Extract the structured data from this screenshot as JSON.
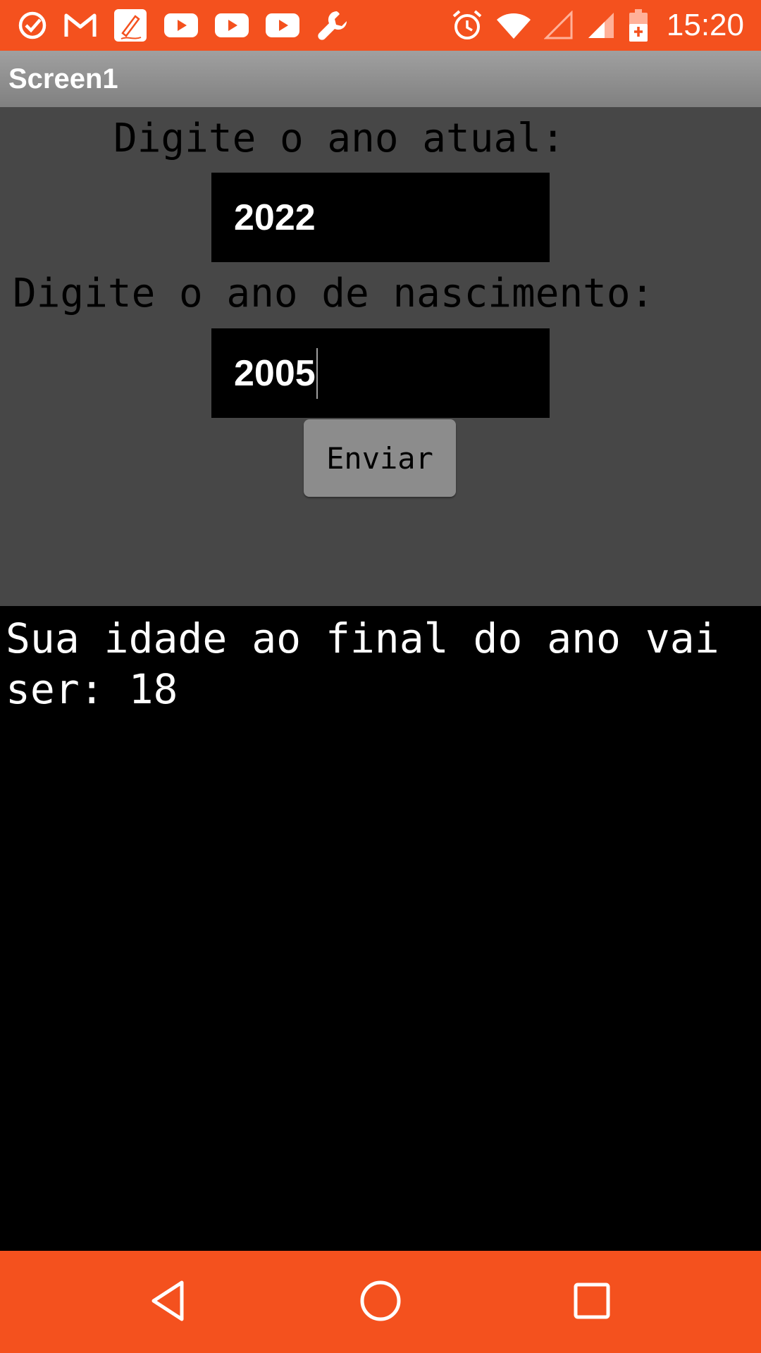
{
  "status_bar": {
    "time": "15:20",
    "left_icons": [
      "check-circle-icon",
      "gmail-icon",
      "notes-pencil-icon",
      "youtube-icon",
      "youtube-icon",
      "youtube-icon",
      "wrench-icon"
    ],
    "right_icons": [
      "alarm-icon",
      "wifi-icon",
      "signal-empty-icon",
      "signal-icon",
      "battery-charging-icon"
    ],
    "background_color": "#F4511E"
  },
  "title_bar": {
    "title": "Screen1"
  },
  "form": {
    "current_year_label": "Digite o ano atual:",
    "current_year_value": "2022",
    "birth_year_label": "Digite o ano de nascimento:",
    "birth_year_value": "2005",
    "submit_label": "Enviar"
  },
  "result": {
    "text": "Sua idade ao final do ano vai ser: 18"
  },
  "nav_bar": {
    "buttons": [
      "back-icon",
      "home-icon",
      "recent-apps-icon"
    ],
    "background_color": "#F4511E"
  }
}
